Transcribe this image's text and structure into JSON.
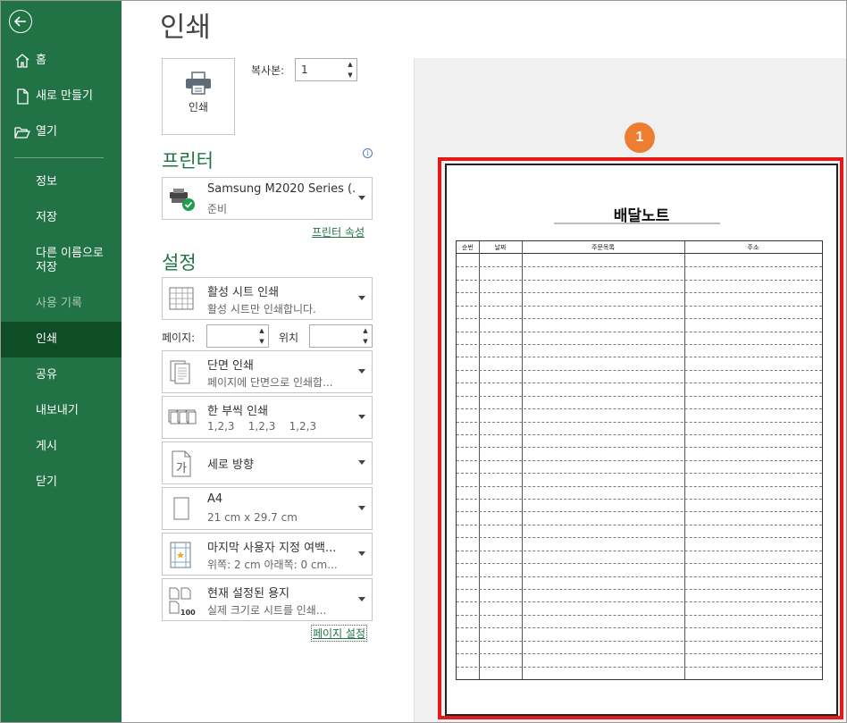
{
  "sidebar": {
    "items": [
      {
        "id": "home",
        "label": "홈",
        "icon": "home-icon"
      },
      {
        "id": "new",
        "label": "새로 만들기",
        "icon": "new-document-icon"
      },
      {
        "id": "open",
        "label": "열기",
        "icon": "folder-open-icon"
      },
      {
        "id": "info",
        "label": "정보"
      },
      {
        "id": "save",
        "label": "저장"
      },
      {
        "id": "save-as",
        "label": "다른 이름으로 저장",
        "label_line1": "다른 이름으로",
        "label_line2": "저장"
      },
      {
        "id": "history",
        "label": "사용 기록",
        "disabled": true
      },
      {
        "id": "print",
        "label": "인쇄",
        "active": true
      },
      {
        "id": "share",
        "label": "공유"
      },
      {
        "id": "export",
        "label": "내보내기"
      },
      {
        "id": "publish",
        "label": "게시"
      },
      {
        "id": "close",
        "label": "닫기"
      }
    ]
  },
  "main": {
    "title": "인쇄",
    "print_button": "인쇄",
    "copies_label": "복사본:",
    "copies_value": "1",
    "printer_section": "프린터",
    "printer": {
      "name": "Samsung M2020 Series (...",
      "status": "준비"
    },
    "printer_properties_link": "프린터 속성",
    "settings_section": "설정",
    "settings": {
      "scope": {
        "title": "활성 시트 인쇄",
        "subtitle": "활성 시트만 인쇄합니다."
      },
      "pages_label": "페이지:",
      "pages_value": "",
      "position_label": "위치",
      "position_value": "",
      "sides": {
        "title": "단면 인쇄",
        "subtitle": "페이지에 단면으로 인쇄합..."
      },
      "collate": {
        "title": "한 부씩 인쇄",
        "subtitle": "1,2,3    1,2,3    1,2,3"
      },
      "orientation": {
        "title": "세로 방향"
      },
      "paper": {
        "title": "A4",
        "subtitle": "21 cm x 29.7 cm"
      },
      "margins": {
        "title": "마지막 사용자 지정 여백...",
        "subtitle": "위쪽: 2 cm 아래쪽: 0 cm..."
      },
      "scaling": {
        "title": "현재 설정된 용지",
        "subtitle": "실제 크기로 시트를 인쇄...",
        "icon_text": "100"
      }
    },
    "page_setup_link": "페이지 설정"
  },
  "preview": {
    "badge": "1",
    "doc_title": "배달노트",
    "columns": [
      "순번",
      "날짜",
      "주문목록",
      "주소"
    ],
    "row_count": 33
  },
  "colors": {
    "sidebar_bg": "#217346",
    "sidebar_active": "#0e4d25",
    "accent_green": "#217346",
    "highlight_red": "#e31a1a",
    "badge_orange": "#ed7d31"
  }
}
